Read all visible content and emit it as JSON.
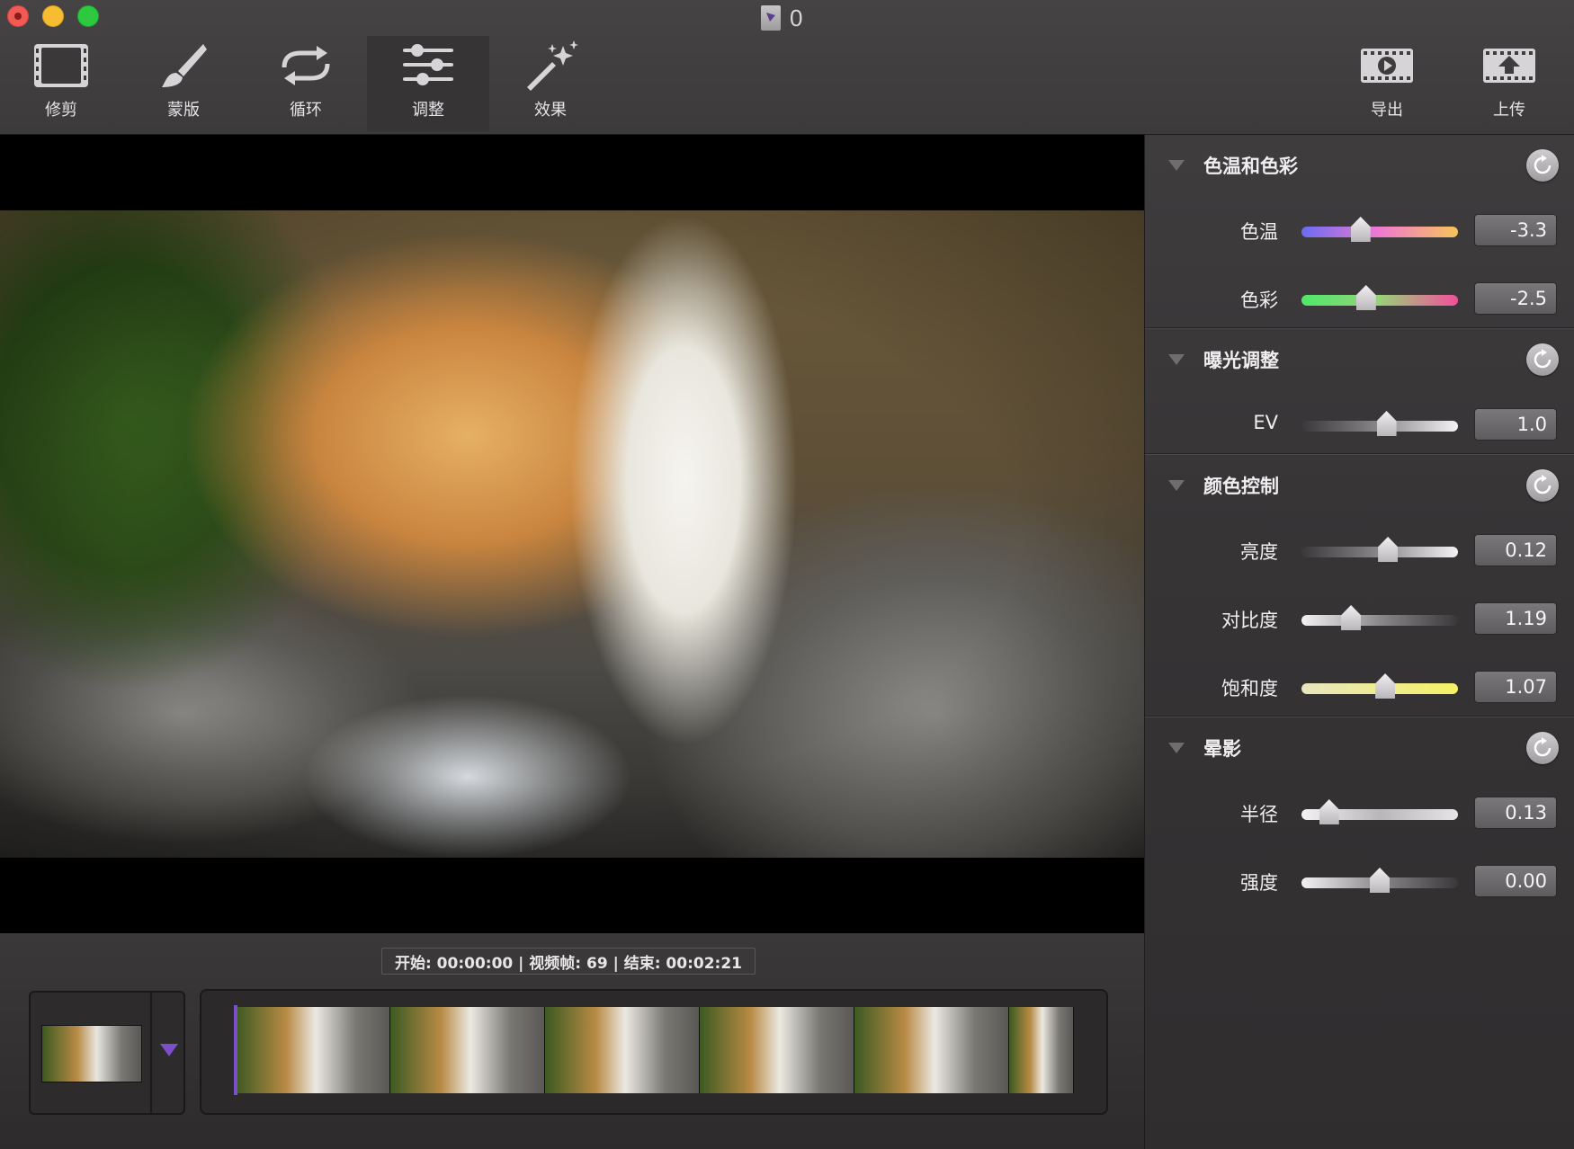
{
  "window": {
    "title": "0"
  },
  "toolbar": {
    "trim_label": "修剪",
    "mask_label": "蒙版",
    "loop_label": "循环",
    "adjust_label": "调整",
    "effects_label": "效果",
    "export_label": "导出",
    "upload_label": "上传"
  },
  "timeline": {
    "timecode": "开始: 00:00:00 | 视频帧: 69 | 结束: 00:02:21"
  },
  "panel": {
    "sections": [
      {
        "title": "色温和色彩",
        "rows": [
          {
            "label": "色温",
            "value": "-3.3",
            "slider": 0.36
          },
          {
            "label": "色彩",
            "value": "-2.5",
            "slider": 0.4
          }
        ]
      },
      {
        "title": "曝光调整",
        "rows": [
          {
            "label": "EV",
            "value": "1.0",
            "slider": 0.55
          }
        ]
      },
      {
        "title": "颜色控制",
        "rows": [
          {
            "label": "亮度",
            "value": "0.12",
            "slider": 0.56
          },
          {
            "label": "对比度",
            "value": "1.19",
            "slider": 0.29
          },
          {
            "label": "饱和度",
            "value": "1.07",
            "slider": 0.54
          }
        ]
      },
      {
        "title": "晕影",
        "rows": [
          {
            "label": "半径",
            "value": "0.13",
            "slider": 0.13
          },
          {
            "label": "强度",
            "value": "0.00",
            "slider": 0.5
          }
        ]
      }
    ]
  },
  "colors": {
    "accent_purple": "#7a4fc9",
    "temp_gradient": [
      "#6a6cf2",
      "#f07ad0",
      "#f6c45a"
    ],
    "tint_gradient": [
      "#4ee86a",
      "#9ad07a",
      "#f0509a"
    ],
    "saturation_gradient": [
      "#e8e6c0",
      "#f4f264"
    ]
  }
}
